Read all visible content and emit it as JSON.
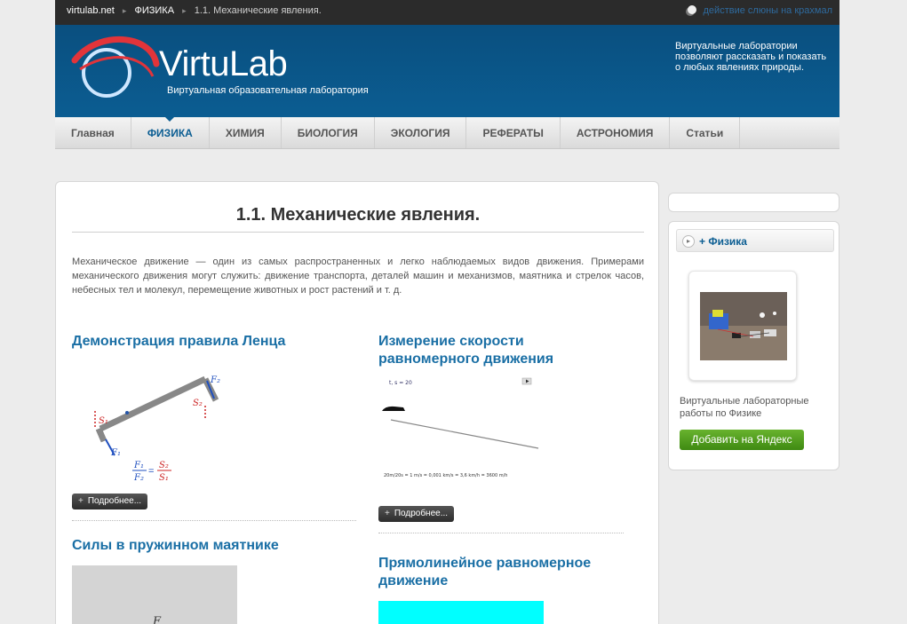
{
  "breadcrumb": {
    "site": "virtulab.net",
    "section": "ФИЗИКА",
    "current": "1.1. Механические явления."
  },
  "tagline": "действие слюны на крахмал",
  "header": {
    "logo_title": "VirtuLab",
    "logo_subtitle": "Виртуальная образовательная лаборатория",
    "note": "Виртуальные лаборатории позволяют рассказать и показать о любых явлениях природы."
  },
  "nav": {
    "items": [
      {
        "label": "Главная"
      },
      {
        "label": "ФИЗИКА"
      },
      {
        "label": "ХИМИЯ"
      },
      {
        "label": "БИОЛОГИЯ"
      },
      {
        "label": "ЭКОЛОГИЯ"
      },
      {
        "label": "РЕФЕРАТЫ"
      },
      {
        "label": "АСТРОНОМИЯ"
      },
      {
        "label": "Статьи"
      }
    ],
    "active": "ФИЗИКА"
  },
  "main": {
    "title": "1.1. Механические явления.",
    "intro": "Механическое движение — один из самых распространенных и легко наблюдаемых видов движения. Примерами механического движения могут служить: движение транспорта, деталей машин и механизмов, маятника и стрелок часов, небесных тел и молекул, перемещение животных и рост растений и т. д.",
    "articles": [
      {
        "title": "Демонстрация правила Ленца",
        "more": "Подробнее..."
      },
      {
        "title": "Измерение скорости равномерного движения",
        "more": "Подробнее..."
      },
      {
        "title": "Силы в пружинном маятнике"
      },
      {
        "title": "Прямолинейное равномерное движение"
      }
    ],
    "lenz_labels": {
      "f2": "F₂",
      "s2": "S₂",
      "s1": "S₁",
      "f1": "F₁",
      "eq_num1": "F₁",
      "eq_den1": "F₂",
      "eq_num2": "S₂",
      "eq_den2": "S₁"
    },
    "speed_labels": {
      "time": "t, s = 20",
      "formula": "20m/20s = 1 m/s = 0,001 km/s = 3,6 km/h = 3600 m/h"
    },
    "spring_label": "F"
  },
  "sidebar": {
    "head": "+ Физика",
    "caption": "Виртуальные лабораторные работы по Физике",
    "button": "Добавить на Яндекс"
  },
  "colors": {
    "header_blue": "#0b5d92",
    "link_blue": "#1a6fa5",
    "button_green": "#4f9c1d",
    "cyan_block": "#00ffff"
  }
}
